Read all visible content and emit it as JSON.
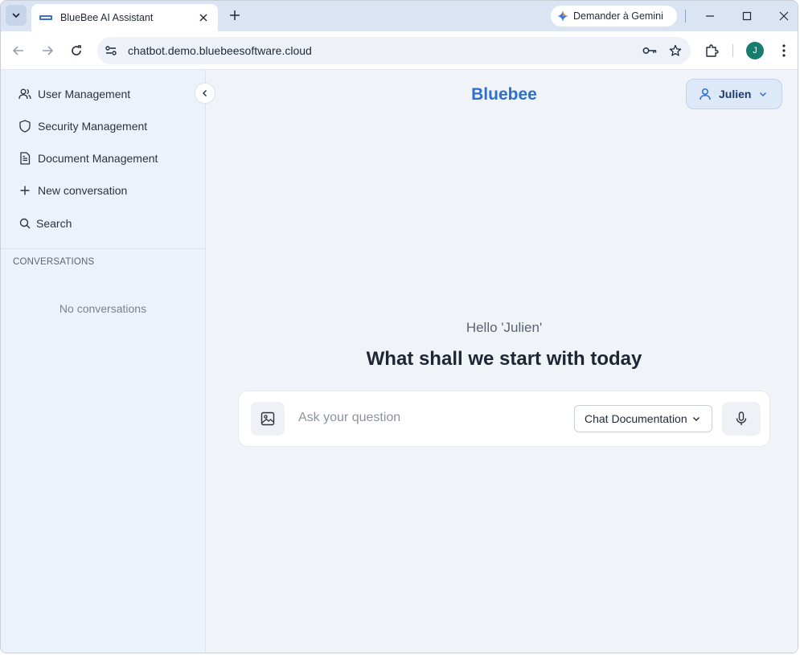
{
  "browser": {
    "tab": {
      "title": "BlueBee AI Assistant",
      "favicon": "bluebee-favicon"
    },
    "gemini_button": "Demander à Gemini",
    "url": "chatbot.demo.bluebeesoftware.cloud",
    "profile_initial": "J"
  },
  "sidebar": {
    "items": [
      {
        "label": "User Management",
        "icon": "users-icon"
      },
      {
        "label": "Security Management",
        "icon": "shield-icon"
      },
      {
        "label": "Document Management",
        "icon": "document-icon"
      },
      {
        "label": "New conversation",
        "icon": "plus-icon"
      },
      {
        "label": "Search",
        "icon": "search-icon"
      }
    ],
    "conversations_heading": "CONVERSATIONS",
    "empty_text": "No conversations"
  },
  "header": {
    "brand": "Bluebee",
    "user_name": "Julien"
  },
  "main": {
    "greeting": "Hello 'Julien'",
    "headline": "What shall we start with today",
    "input_placeholder": "Ask your question",
    "mode_selected": "Chat Documentation"
  },
  "colors": {
    "brand": "#2d6fd1",
    "sidebar_bg": "#ecf2fb",
    "main_bg": "#f0f3f8",
    "profile": "#177e6f"
  }
}
